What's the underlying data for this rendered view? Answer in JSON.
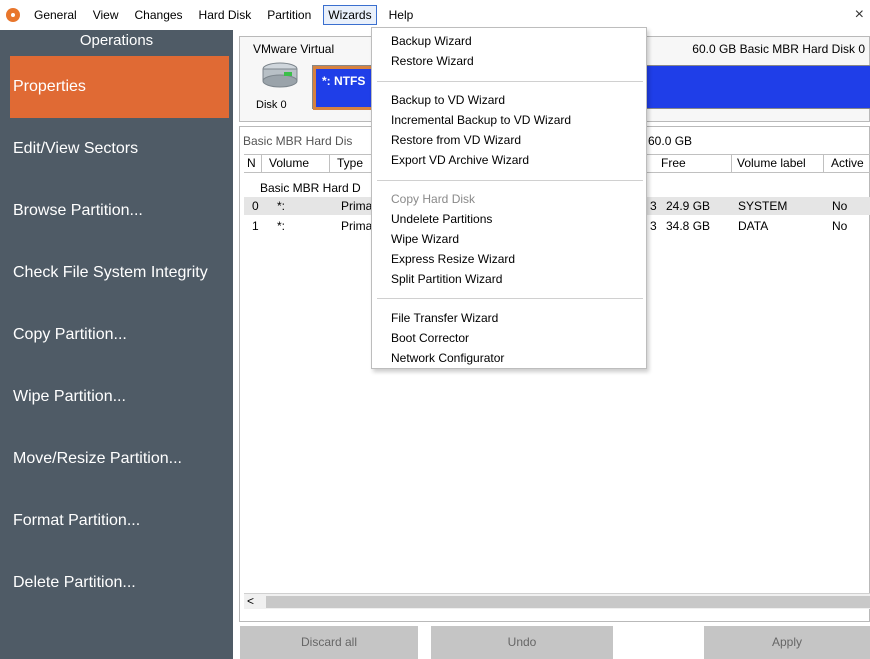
{
  "menubar": {
    "items": [
      "General",
      "View",
      "Changes",
      "Hard Disk",
      "Partition",
      "Wizards",
      "Help"
    ],
    "close_glyph": "×"
  },
  "sidebar": {
    "title": "Operations",
    "items": [
      "Properties",
      "Edit/View Sectors",
      "Browse Partition...",
      "Check File System Integrity",
      "Copy Partition...",
      "Wipe Partition...",
      "Move/Resize Partition...",
      "Format Partition...",
      "Delete Partition..."
    ]
  },
  "disk_panel": {
    "name": "VMware Virtual",
    "info": "60.0 GB Basic MBR Hard Disk 0",
    "disk_label": "Disk 0",
    "partition_label": "*: NTFS"
  },
  "table": {
    "title_left": "Basic MBR Hard Dis",
    "title_right": "e 60.0 GB",
    "headers": [
      "N",
      "Volume",
      "Type",
      "Free",
      "Volume label",
      "Active"
    ],
    "group_label": "Basic MBR Hard D",
    "rows": [
      {
        "n": "0",
        "volume": "*:",
        "type": "Prima",
        "size_suffix": "3",
        "free": "24.9 GB",
        "label": "SYSTEM",
        "active": "No"
      },
      {
        "n": "1",
        "volume": "*:",
        "type": "Prima",
        "size_suffix": "3",
        "free": "34.8 GB",
        "label": "DATA",
        "active": "No"
      }
    ],
    "scroll_left": "<"
  },
  "buttons": {
    "discard": "Discard all",
    "undo": "Undo",
    "apply": "Apply"
  },
  "wizards_menu": {
    "group1": [
      "Backup Wizard",
      "Restore Wizard"
    ],
    "group2": [
      "Backup to VD Wizard",
      "Incremental Backup to VD Wizard",
      "Restore from VD Wizard",
      "Export VD Archive Wizard"
    ],
    "group3_disabled": "Copy Hard Disk",
    "group3": [
      "Undelete Partitions",
      "Wipe Wizard",
      "Express Resize Wizard",
      "Split Partition Wizard"
    ],
    "group4": [
      "File Transfer Wizard",
      "Boot Corrector",
      "Network Configurator"
    ]
  },
  "colors": {
    "sidebar_bg": "#4f5b66",
    "selected_op": "#e06a34",
    "partition_blue": "#1f3ee8"
  }
}
